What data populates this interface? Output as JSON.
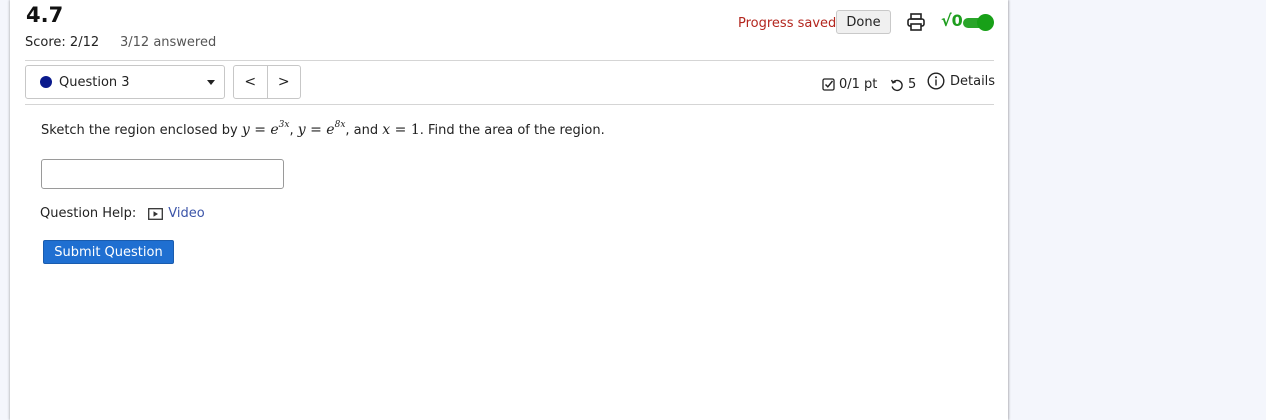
{
  "header": {
    "title": "4.7",
    "score": "Score: 2/12",
    "answered": "3/12 answered",
    "progress_saved": "Progress saved",
    "done_label": "Done"
  },
  "toolbar": {
    "question_selector": "Question 3",
    "prev_label": "<",
    "next_label": ">",
    "points": "0/1 pt",
    "retries": "5",
    "details_label": "Details"
  },
  "question": {
    "text_prefix": "Sketch the region enclosed by",
    "eq1": {
      "lhs": "y = e",
      "exp": "3x"
    },
    "sep1": ",",
    "eq2": {
      "lhs": "y = e",
      "exp": "8x"
    },
    "sep2": ", and",
    "eq3": {
      "var": "x = ",
      "num": "1"
    },
    "text_suffix": ". Find the area of the region.",
    "answer_value": ""
  },
  "help": {
    "label": "Question Help:",
    "video_label": "Video"
  },
  "submit_label": "Submit Question",
  "colors": {
    "saved_text": "#b3261e",
    "submit_bg": "#1f6fd1",
    "toggle_green": "#18a018",
    "question_dot": "#0a1a8c",
    "video_link": "#3b54a8"
  },
  "icons": [
    "print-icon",
    "sqrt-icon",
    "toggle-switch",
    "chevron-down-icon",
    "checkbox-icon",
    "retry-icon",
    "info-icon",
    "video-icon"
  ]
}
